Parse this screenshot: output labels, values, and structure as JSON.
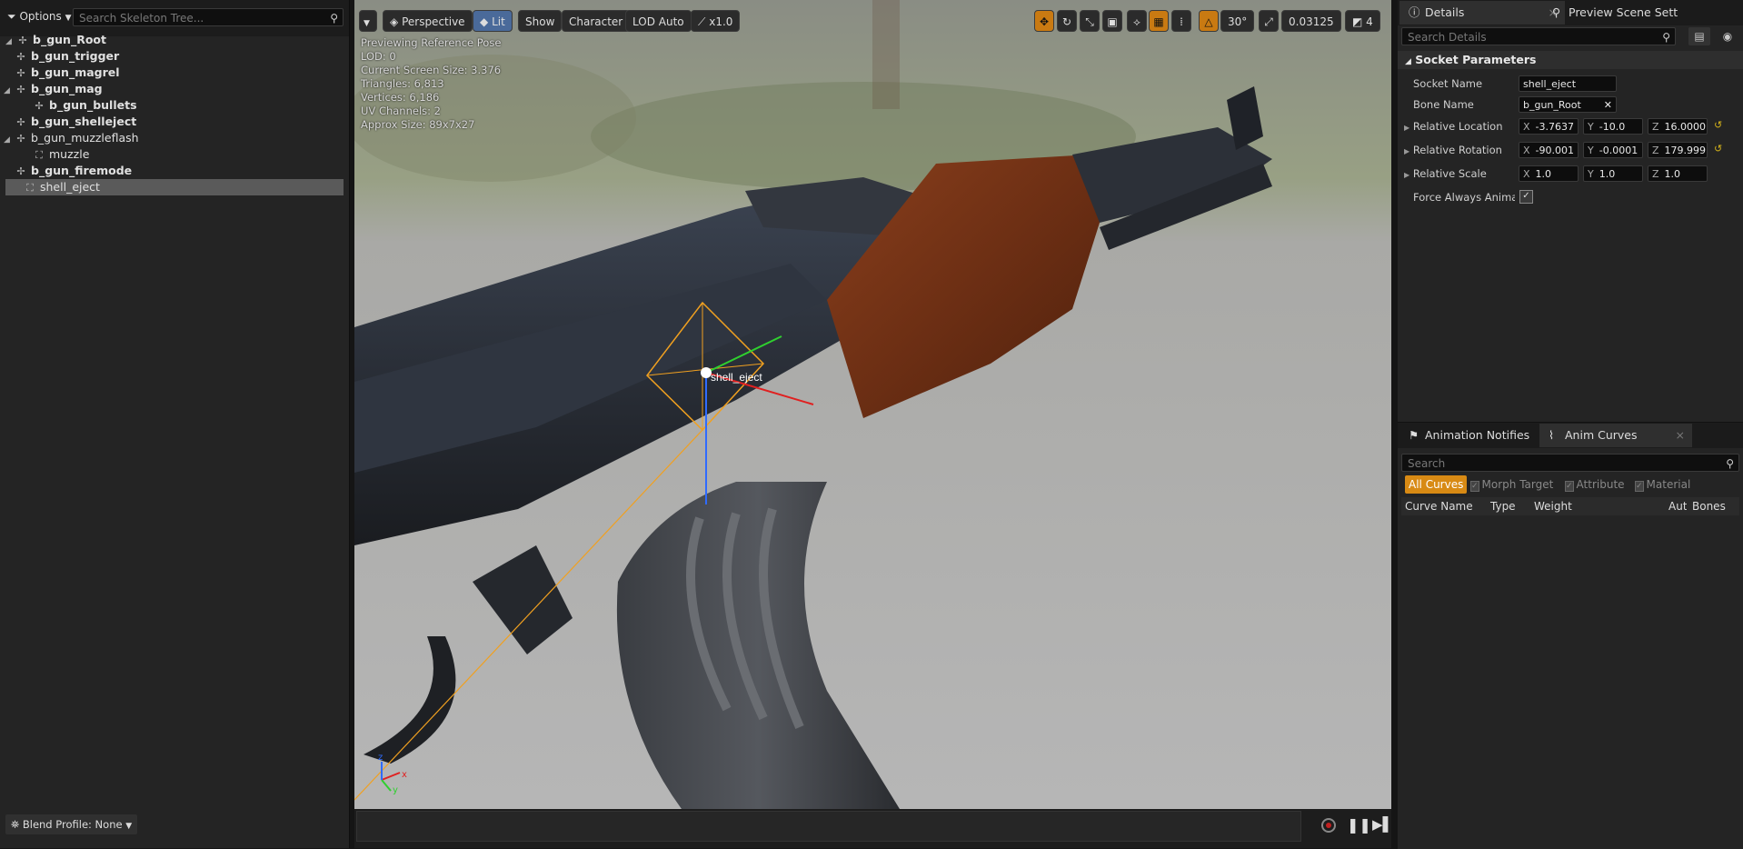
{
  "skeleton": {
    "options_label": "Options",
    "search_placeholder": "Search Skeleton Tree...",
    "items": [
      {
        "label": "b_gun_Root",
        "bold": true
      },
      {
        "label": "b_gun_trigger",
        "bold": true
      },
      {
        "label": "b_gun_magrel",
        "bold": true
      },
      {
        "label": "b_gun_mag",
        "bold": true
      },
      {
        "label": "b_gun_bullets",
        "bold": true
      },
      {
        "label": "b_gun_shelleject",
        "bold": true
      },
      {
        "label": "b_gun_muzzleflash",
        "bold": false
      },
      {
        "label": "muzzle",
        "bold": false
      },
      {
        "label": "b_gun_firemode",
        "bold": true
      },
      {
        "label": "shell_eject",
        "bold": false
      }
    ],
    "blend_profile": "Blend Profile: None"
  },
  "viewport": {
    "toolbar": {
      "perspective": "Perspective",
      "lit": "Lit",
      "show": "Show",
      "character": "Character",
      "lod": "LOD Auto",
      "speed": "x1.0",
      "angle": "30°",
      "scale": "0.03125",
      "camera_speed": "4"
    },
    "stats": [
      "Previewing Reference Pose",
      "LOD: 0",
      "Current Screen Size: 3.376",
      "Triangles: 6,813",
      "Vertices: 6,186",
      "UV Channels: 2",
      "Approx Size: 89x7x27"
    ],
    "socket_label": "shell_eject",
    "axis_x": "x",
    "axis_y": "y",
    "axis_z": "z"
  },
  "details": {
    "tab_details": "Details",
    "tab_preview": "Preview Scene Sett",
    "search_placeholder": "Search Details",
    "section": "Socket Parameters",
    "socket_name_label": "Socket Name",
    "socket_name_value": "shell_eject",
    "bone_name_label": "Bone Name",
    "bone_name_value": "b_gun_Root",
    "rel_location_label": "Relative Location",
    "rel_location": {
      "x": "-3.7637",
      "y": "-10.0",
      "z": "16.0000"
    },
    "rel_rotation_label": "Relative Rotation",
    "rel_rotation": {
      "x": "-90.001",
      "y": "-0.0001",
      "z": "179.999"
    },
    "rel_scale_label": "Relative Scale",
    "rel_scale": {
      "x": "1.0",
      "y": "1.0",
      "z": "1.0"
    },
    "force_label": "Force Always Animate"
  },
  "curves": {
    "tab_notifies": "Animation Notifies",
    "tab_curves": "Anim Curves",
    "search_placeholder": "Search",
    "filter_all": "All Curves",
    "filter_morph": "Morph Target",
    "filter_attribute": "Attribute",
    "filter_material": "Material",
    "col_name": "Curve Name",
    "col_type": "Type",
    "col_weight": "Weight",
    "col_auto": "Auto",
    "col_bones": "Bones"
  }
}
